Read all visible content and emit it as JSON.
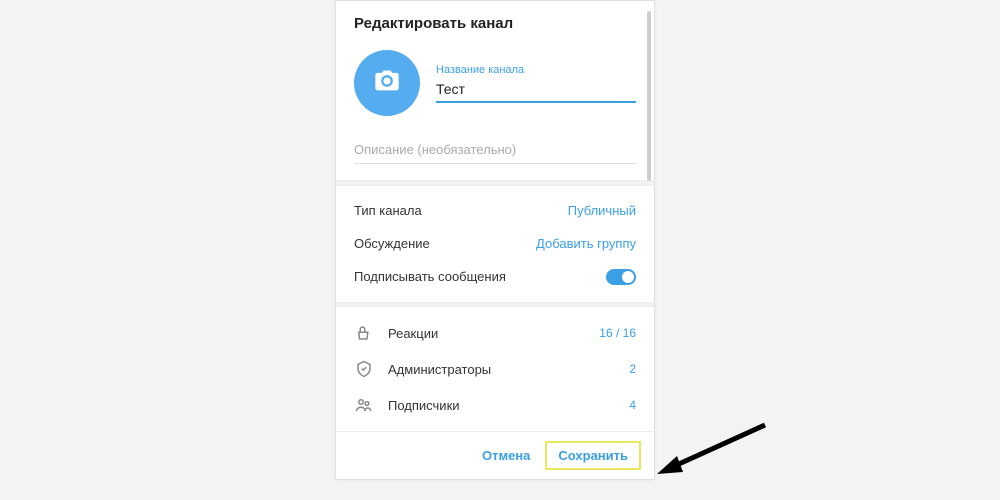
{
  "colors": {
    "accent": "#3a9fe4",
    "highlight": "#e8e85a"
  },
  "header": {
    "title": "Редактировать канал"
  },
  "name_field": {
    "label": "Название канала",
    "value": "Тест"
  },
  "description": {
    "placeholder": "Описание (необязательно)",
    "value": ""
  },
  "settings": {
    "type": {
      "label": "Тип канала",
      "value": "Публичный"
    },
    "discussion": {
      "label": "Обсуждение",
      "value": "Добавить группу"
    },
    "sign": {
      "label": "Подписывать сообщения",
      "on": true
    }
  },
  "rows": {
    "reactions": {
      "label": "Реакции",
      "value": "16 / 16"
    },
    "admins": {
      "label": "Администраторы",
      "value": "2"
    },
    "subs": {
      "label": "Подписчики",
      "value": "4"
    }
  },
  "footer": {
    "cancel": "Отмена",
    "save": "Сохранить"
  }
}
